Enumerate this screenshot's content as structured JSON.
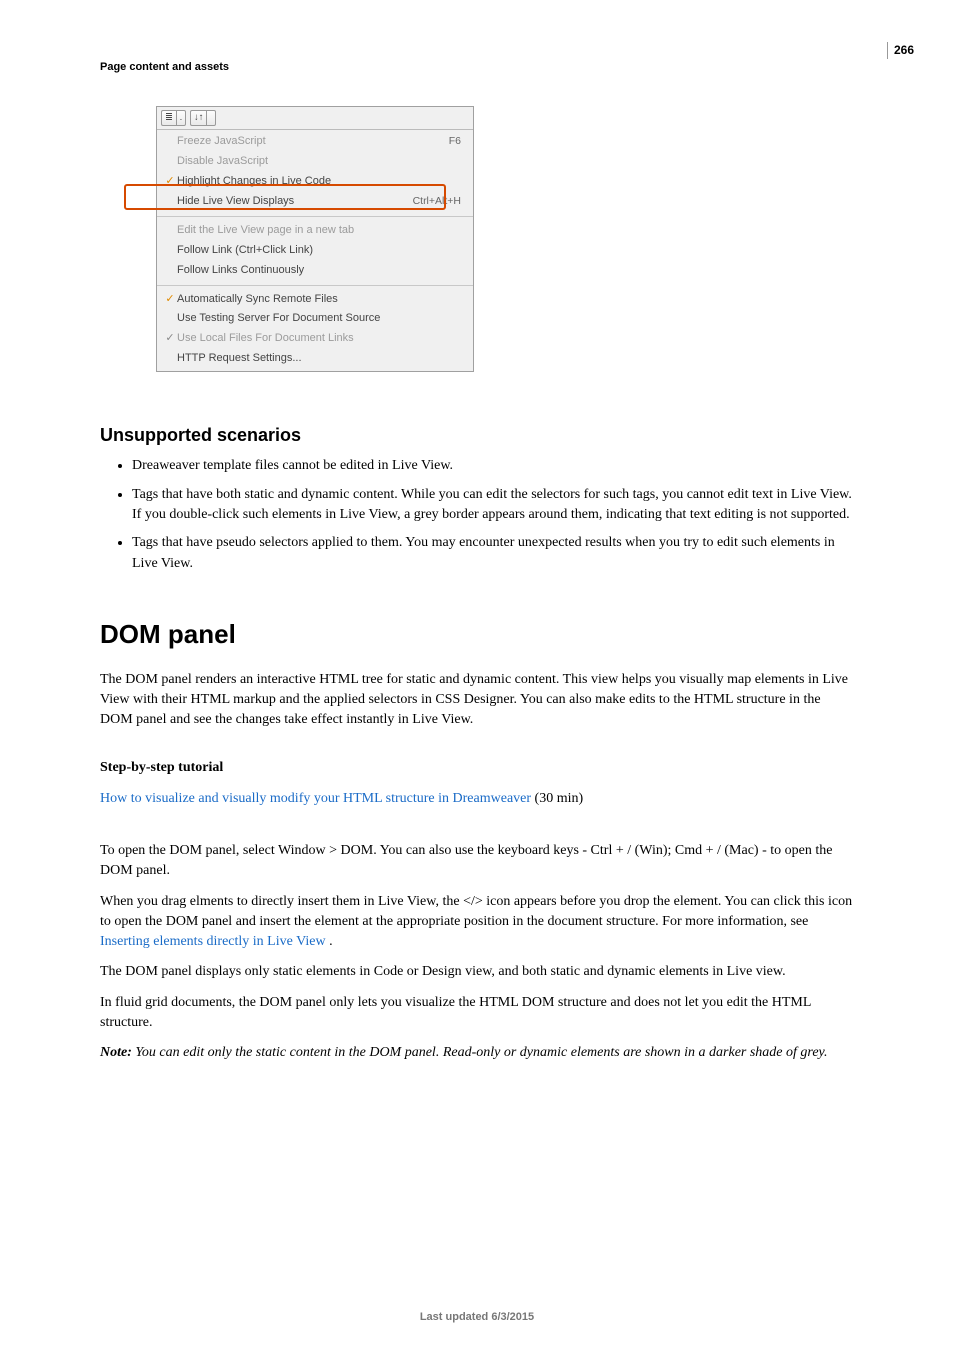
{
  "page_number": "266",
  "breadcrumb": "Page content and assets",
  "menu": {
    "tb_icon_lines": "≣",
    "tb_icon_sort": "↓↑",
    "items1": [
      {
        "chk": "",
        "label": "Freeze JavaScript",
        "shortcut": "F6",
        "disabled": true
      },
      {
        "chk": "",
        "label": "Disable JavaScript",
        "shortcut": "",
        "disabled": true
      },
      {
        "chk": "✓",
        "label": "Highlight Changes in Live Code",
        "shortcut": "",
        "disabled": false
      },
      {
        "chk": "",
        "label": "Hide Live View Displays",
        "shortcut": "Ctrl+Alt+H",
        "disabled": false
      }
    ],
    "items2": [
      {
        "chk": "",
        "label": "Edit the Live View page in a new tab",
        "disabled": true
      },
      {
        "chk": "",
        "label": "Follow Link (Ctrl+Click Link)",
        "disabled": false
      },
      {
        "chk": "",
        "label": "Follow Links Continuously",
        "disabled": false
      }
    ],
    "items3": [
      {
        "chk": "✓",
        "label": "Automatically Sync Remote Files",
        "disabled": false
      },
      {
        "chk": "",
        "label": "Use Testing Server For Document Source",
        "disabled": false
      },
      {
        "chk": "✓",
        "chkgrey": true,
        "label": "Use Local Files For Document Links",
        "disabled": true
      },
      {
        "chk": "",
        "label": "HTTP Request Settings...",
        "disabled": false
      }
    ]
  },
  "unsupported": {
    "heading": "Unsupported scenarios",
    "b1": "Dreaweaver template files cannot be edited in Live View.",
    "b2": "Tags that have both static and dynamic content. While you can edit the selectors for such tags, you cannot edit text in Live View. If you double-click such elements in Live View, a grey border appears around them, indicating that text editing is not supported.",
    "b3": "Tags that have pseudo selectors applied to them. You may encounter unexpected results when you try to edit such elements in Live View."
  },
  "dom": {
    "heading": "DOM panel",
    "p1": "The DOM panel renders an interactive HTML tree for static and dynamic content. This view helps you visually map elements in Live View with their HTML markup and the applied selectors in CSS Designer. You can also make edits to the HTML structure in the DOM panel and see the changes take effect instantly in Live View.",
    "step_heading": "Step-by-step tutorial",
    "tutorial_link": "How to visualize and visually modify your HTML structure in Dreamweaver",
    "tutorial_tail": " (30 min)",
    "p2": "To open the DOM panel, select Window > DOM. You can also use the keyboard keys - Ctrl + / (Win); Cmd + / (Mac) - to open the DOM panel.",
    "p3a": "When you drag elments to directly insert them in Live View, the </> icon appears before you drop the element. You can click this icon to open the DOM panel and insert the element at the appropriate position in the document structure. For more information, see ",
    "p3link": "Inserting elements directly in Live View ",
    "p3b": ".",
    "p4": "The DOM panel displays only static elements in Code or Design view, and both static and dynamic elements in Live view.",
    "p5": "In fluid grid documents, the DOM panel only lets you visualize the HTML DOM structure and does not let you edit the HTML structure.",
    "note_lead": "Note: ",
    "note_body": "You can edit only the static content in the DOM panel. Read-only or dynamic elements are shown in a darker shade of grey."
  },
  "footer": "Last updated 6/3/2015"
}
